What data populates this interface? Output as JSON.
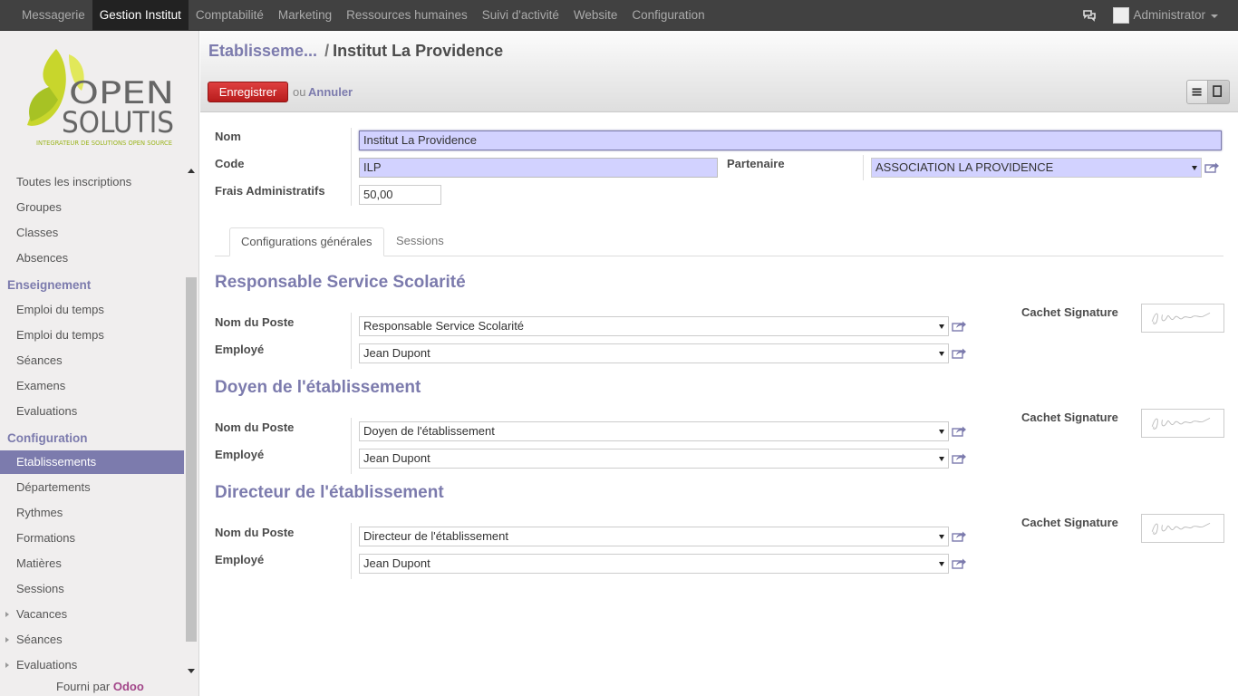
{
  "topbar": {
    "menu": [
      "Messagerie",
      "Gestion Institut",
      "Comptabilité",
      "Marketing",
      "Ressources humaines",
      "Suivi d'activité",
      "Website",
      "Configuration"
    ],
    "active_index": 1,
    "user_name": "Administrator",
    "chat_icon": "chat-bubbles-icon"
  },
  "sidebar": {
    "logo": {
      "line1": "OPEN",
      "line2": "SOLUTIS",
      "tagline": "INTEGRATEUR DE SOLUTIONS OPEN SOURCE"
    },
    "items": [
      {
        "label": "Toutes les inscriptions"
      },
      {
        "label": "Groupes"
      },
      {
        "label": "Classes"
      },
      {
        "label": "Absences"
      }
    ],
    "enseignement_header": "Enseignement",
    "enseignement_items": [
      {
        "label": "Emploi du temps"
      },
      {
        "label": "Emploi du temps"
      },
      {
        "label": "Séances"
      },
      {
        "label": "Examens"
      },
      {
        "label": "Evaluations"
      }
    ],
    "configuration_header": "Configuration",
    "configuration_items": [
      {
        "label": "Etablissements"
      },
      {
        "label": "Départements"
      },
      {
        "label": "Rythmes"
      },
      {
        "label": "Formations"
      },
      {
        "label": "Matières"
      },
      {
        "label": "Sessions"
      },
      {
        "label": "Vacances"
      },
      {
        "label": "Séances"
      },
      {
        "label": "Evaluations"
      }
    ],
    "powered_prefix": "Fourni par",
    "powered_brand": "Odoo"
  },
  "control": {
    "breadcrumb_parent": "Etablisseme...",
    "breadcrumb_sep": "/",
    "breadcrumb_current": "Institut La Providence",
    "save_label": "Enregistrer",
    "or_text": "ou",
    "cancel_label": "Annuler"
  },
  "form": {
    "nom_label": "Nom",
    "nom_value": "Institut La Providence",
    "code_label": "Code",
    "code_value": "ILP",
    "partenaire_label": "Partenaire",
    "partenaire_value": "ASSOCIATION LA PROVIDENCE",
    "frais_label": "Frais Administratifs",
    "frais_value": "50,00",
    "tabs": [
      "Configurations générales",
      "Sessions"
    ],
    "sections": [
      {
        "title": "Responsable Service Scolarité",
        "poste_label": "Nom du Poste",
        "poste_value": "Responsable Service Scolarité",
        "employe_label": "Employé",
        "employe_value": "Jean Dupont",
        "cachet_label": "Cachet Signature"
      },
      {
        "title": "Doyen de l'établissement",
        "poste_label": "Nom du Poste",
        "poste_value": "Doyen de l'établissement",
        "employe_label": "Employé",
        "employe_value": "Jean Dupont",
        "cachet_label": "Cachet Signature"
      },
      {
        "title": "Directeur de l'établissement",
        "poste_label": "Nom du Poste",
        "poste_value": "Directeur de l'établissement",
        "employe_label": "Employé",
        "employe_value": "Jean Dupont",
        "cachet_label": "Cachet Signature"
      }
    ]
  },
  "colors": {
    "accent": "#7c7bad",
    "topbar_bg": "#414141",
    "required_field": "#d2d2ff",
    "save_button": "#c62828"
  }
}
